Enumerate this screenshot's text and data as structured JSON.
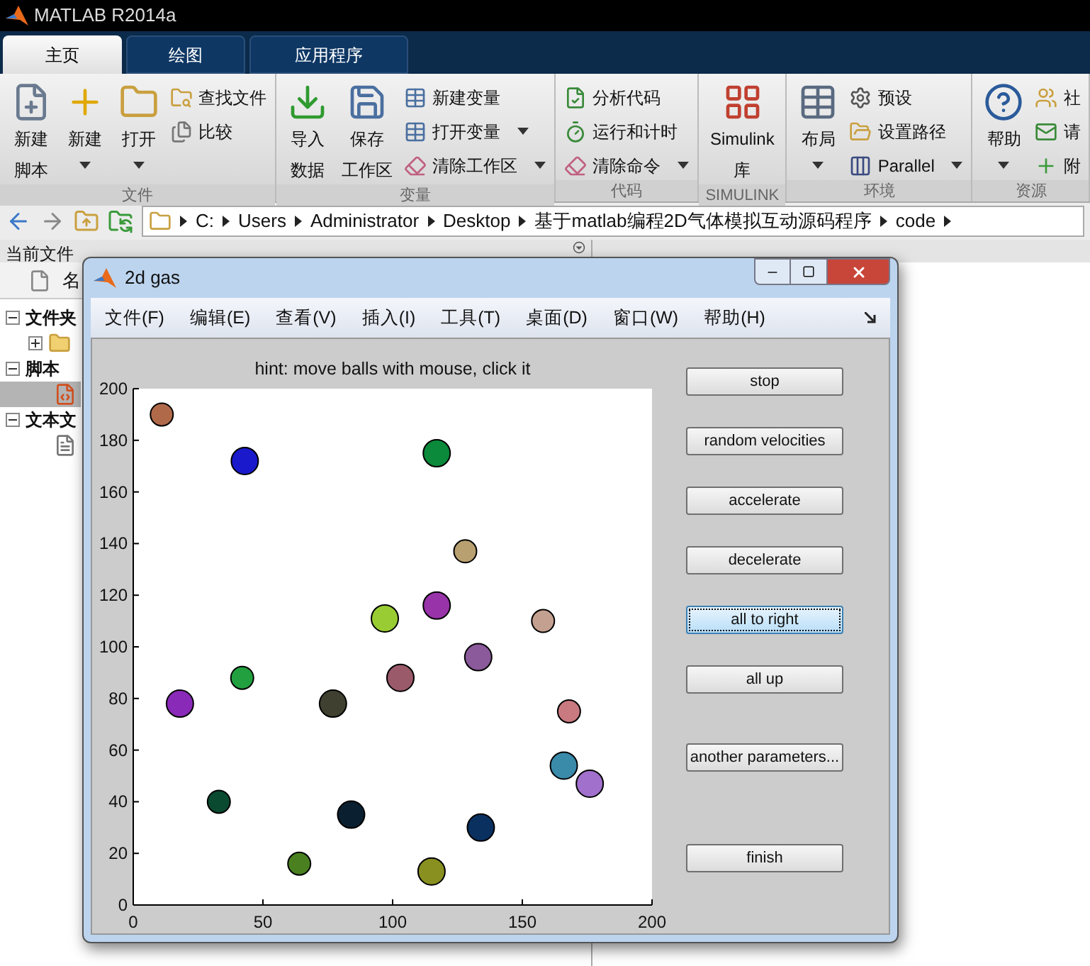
{
  "app_title": "MATLAB R2014a",
  "tabs": [
    {
      "label": "主页",
      "selected": true
    },
    {
      "label": "绘图",
      "selected": false
    },
    {
      "label": "应用程序",
      "selected": false
    }
  ],
  "ribbon": [
    {
      "label": "文件",
      "items": [
        {
          "kind": "large",
          "lines": [
            "新建",
            "脚本"
          ],
          "dropdown": false
        },
        {
          "kind": "large",
          "lines": [
            "新建"
          ],
          "dropdown": true
        },
        {
          "kind": "large",
          "lines": [
            "打开"
          ],
          "dropdown": true
        },
        {
          "kind": "small",
          "label": "查找文件",
          "dropdown": false
        },
        {
          "kind": "small",
          "label": "比较",
          "dropdown": false
        }
      ]
    },
    {
      "label": "变量",
      "items": [
        {
          "kind": "large",
          "lines": [
            "导入",
            "数据"
          ],
          "dropdown": false
        },
        {
          "kind": "large",
          "lines": [
            "保存",
            "工作区"
          ],
          "dropdown": false
        },
        {
          "kind": "small",
          "label": "新建变量",
          "dropdown": false
        },
        {
          "kind": "small",
          "label": "打开变量",
          "dropdown": true
        },
        {
          "kind": "small",
          "label": "清除工作区",
          "dropdown": true
        }
      ]
    },
    {
      "label": "代码",
      "items": [
        {
          "kind": "small",
          "label": "分析代码",
          "dropdown": false
        },
        {
          "kind": "small",
          "label": "运行和计时",
          "dropdown": false
        },
        {
          "kind": "small",
          "label": "清除命令",
          "dropdown": true
        }
      ]
    },
    {
      "label": "SIMULINK",
      "items": [
        {
          "kind": "large",
          "lines": [
            "Simulink",
            "库"
          ],
          "dropdown": false
        }
      ]
    },
    {
      "label": "环境",
      "items": [
        {
          "kind": "large",
          "lines": [
            "布局"
          ],
          "dropdown": true
        },
        {
          "kind": "small",
          "label": "预设",
          "dropdown": false
        },
        {
          "kind": "small",
          "label": "设置路径",
          "dropdown": false
        },
        {
          "kind": "small",
          "label": "Parallel",
          "dropdown": true
        }
      ]
    },
    {
      "label": "资源",
      "items": [
        {
          "kind": "large",
          "lines": [
            "帮助"
          ],
          "dropdown": true
        },
        {
          "kind": "small",
          "label": "社",
          "dropdown": false
        },
        {
          "kind": "small",
          "label": "请",
          "dropdown": false
        },
        {
          "kind": "small",
          "label": "附",
          "dropdown": false
        }
      ]
    }
  ],
  "path": [
    "C:",
    "Users",
    "Administrator",
    "Desktop",
    "基于matlab编程2D气体模拟互动源码程序",
    "code"
  ],
  "file_panel": {
    "title": "当前文件",
    "column": "名",
    "tree": [
      {
        "label": "文件夹",
        "expanded": true,
        "children": [
          {
            "kind": "folder",
            "expanded": false,
            "selected": false
          }
        ]
      },
      {
        "label": "脚本",
        "expanded": true,
        "children": [
          {
            "kind": "script",
            "selected": true
          }
        ]
      },
      {
        "label": "文本文",
        "expanded": true,
        "children": [
          {
            "kind": "text",
            "selected": false
          }
        ]
      }
    ]
  },
  "figure": {
    "title": "2d gas",
    "menu": [
      "文件(F)",
      "编辑(E)",
      "查看(V)",
      "插入(I)",
      "工具(T)",
      "桌面(D)",
      "窗口(W)",
      "帮助(H)"
    ],
    "chart_data": {
      "type": "scatter",
      "title": "hint: move balls with mouse, click it",
      "xlim": [
        0,
        200
      ],
      "ylim": [
        0,
        200
      ],
      "xticks": [
        0,
        50,
        100,
        150,
        200
      ],
      "yticks": [
        0,
        20,
        40,
        60,
        80,
        100,
        120,
        140,
        160,
        180,
        200
      ],
      "x": [
        11,
        43,
        117,
        128,
        97,
        117,
        158,
        133,
        103,
        42,
        18,
        77,
        168,
        166,
        176,
        33,
        84,
        134,
        64,
        115
      ],
      "series": [
        {
          "values": [
            190,
            172,
            175,
            137,
            111,
            116,
            110,
            96,
            88,
            88,
            78,
            78,
            75,
            54,
            47,
            40,
            35,
            30,
            16,
            13
          ],
          "colors": [
            "#b06a4a",
            "#1a1acc",
            "#0a8a3a",
            "#b8a070",
            "#99cc33",
            "#9933aa",
            "#c4a090",
            "#8a5a9a",
            "#9a5a6a",
            "#22a040",
            "#8a2ab8",
            "#404030",
            "#c87a80",
            "#3a8aaa",
            "#a070cc",
            "#0a4a30",
            "#0a2030",
            "#0a3060",
            "#4a8020",
            "#8a9020"
          ]
        }
      ]
    },
    "buttons": [
      {
        "label": "stop",
        "focused": false
      },
      {
        "label": "random velocities",
        "focused": false
      },
      {
        "label": "accelerate",
        "focused": false
      },
      {
        "label": "decelerate",
        "focused": false
      },
      {
        "label": "all to right",
        "focused": true
      },
      {
        "label": "all up",
        "focused": false
      },
      {
        "label": "another parameters...",
        "focused": false
      },
      {
        "label": "finish",
        "focused": false
      }
    ]
  }
}
